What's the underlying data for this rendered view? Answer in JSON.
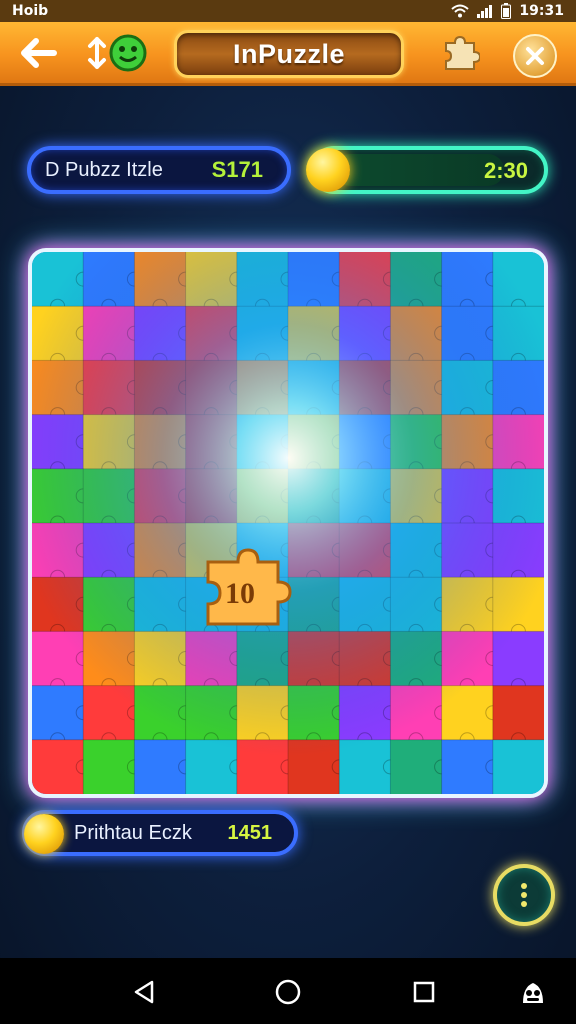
{
  "status_bar": {
    "left_text": "Hoib",
    "time": "19:31",
    "icons": [
      "wifi-icon",
      "signal-icon",
      "battery-icon"
    ]
  },
  "header": {
    "title": "InPuzzle",
    "back_icon": "arrow-left-icon",
    "sort_icon": "up-down-arrows-icon",
    "avatar_icon": "green-smiley-icon",
    "puzzle_icon": "puzzle-piece-icon",
    "close_icon": "close-icon"
  },
  "player_bar": {
    "label": "D Pubzz Itzle",
    "score": "S171"
  },
  "progress_bar": {
    "value_text": "2:30",
    "coin_icon": "gold-coin-icon",
    "fill_fraction": 0.85
  },
  "board": {
    "rows": 10,
    "cols": 10,
    "center_badge": "10",
    "palette": [
      "#ff3b3b",
      "#ff8c1a",
      "#ffd21f",
      "#3ad12c",
      "#19c2d6",
      "#2f7bff",
      "#8a3cff",
      "#ff3fb4",
      "#1fae7a",
      "#e0361f"
    ]
  },
  "info_bar": {
    "label": "Prithtau Eczk",
    "value": "1451",
    "coin_icon": "gold-coin-icon"
  },
  "more_button": {
    "icon": "vertical-dots-icon"
  },
  "nav_bar": {
    "back": "nav-back-icon",
    "home": "nav-home-icon",
    "recents": "nav-recents-icon",
    "assistant": "assistant-icon"
  }
}
